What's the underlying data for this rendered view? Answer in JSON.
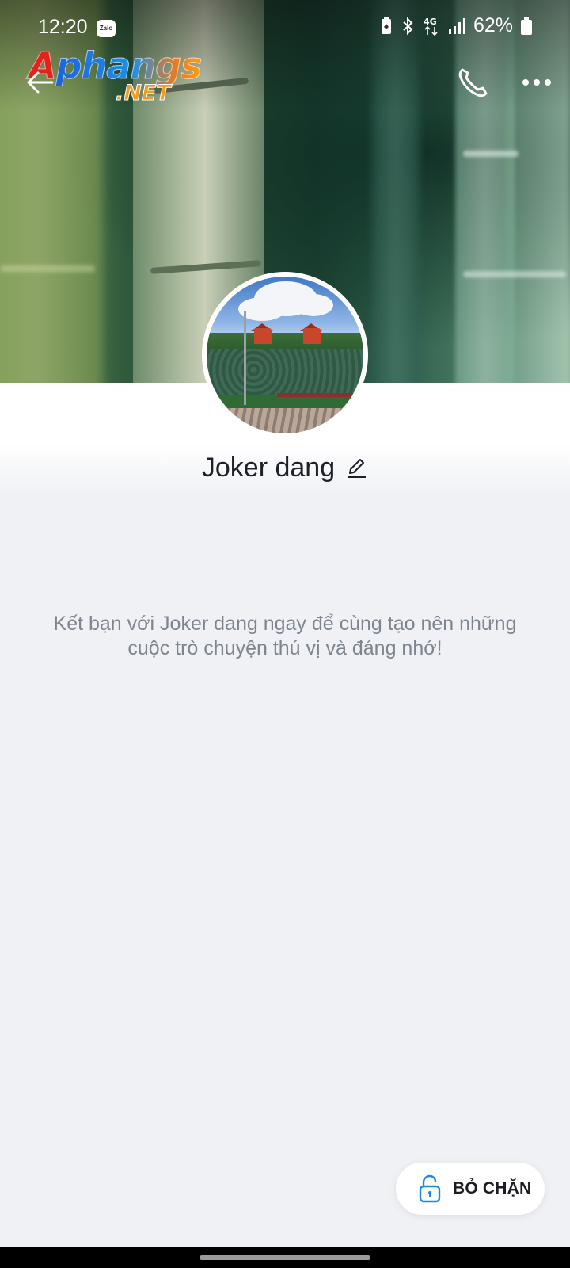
{
  "status_bar": {
    "time": "12:20",
    "app_badge": "Zalo",
    "network": "4G",
    "battery_percent": "62%"
  },
  "watermark": {
    "main": "Aphangs",
    "sub": ".NET"
  },
  "profile": {
    "name": "Joker dang"
  },
  "intro_text": "Kết bạn với Joker dang ngay để cùng tạo nên những cuộc trò chuyện thú vị và đáng nhớ!",
  "unblock": {
    "label": "BỎ CHẶN"
  },
  "colors": {
    "accent": "#1e88e5",
    "background": "#eff1f5",
    "text_secondary": "#7e858f"
  },
  "icons": {
    "back": "arrow-left-icon",
    "call": "phone-icon",
    "more": "more-horizontal-icon",
    "edit": "pencil-icon",
    "unblock": "unlock-icon"
  }
}
